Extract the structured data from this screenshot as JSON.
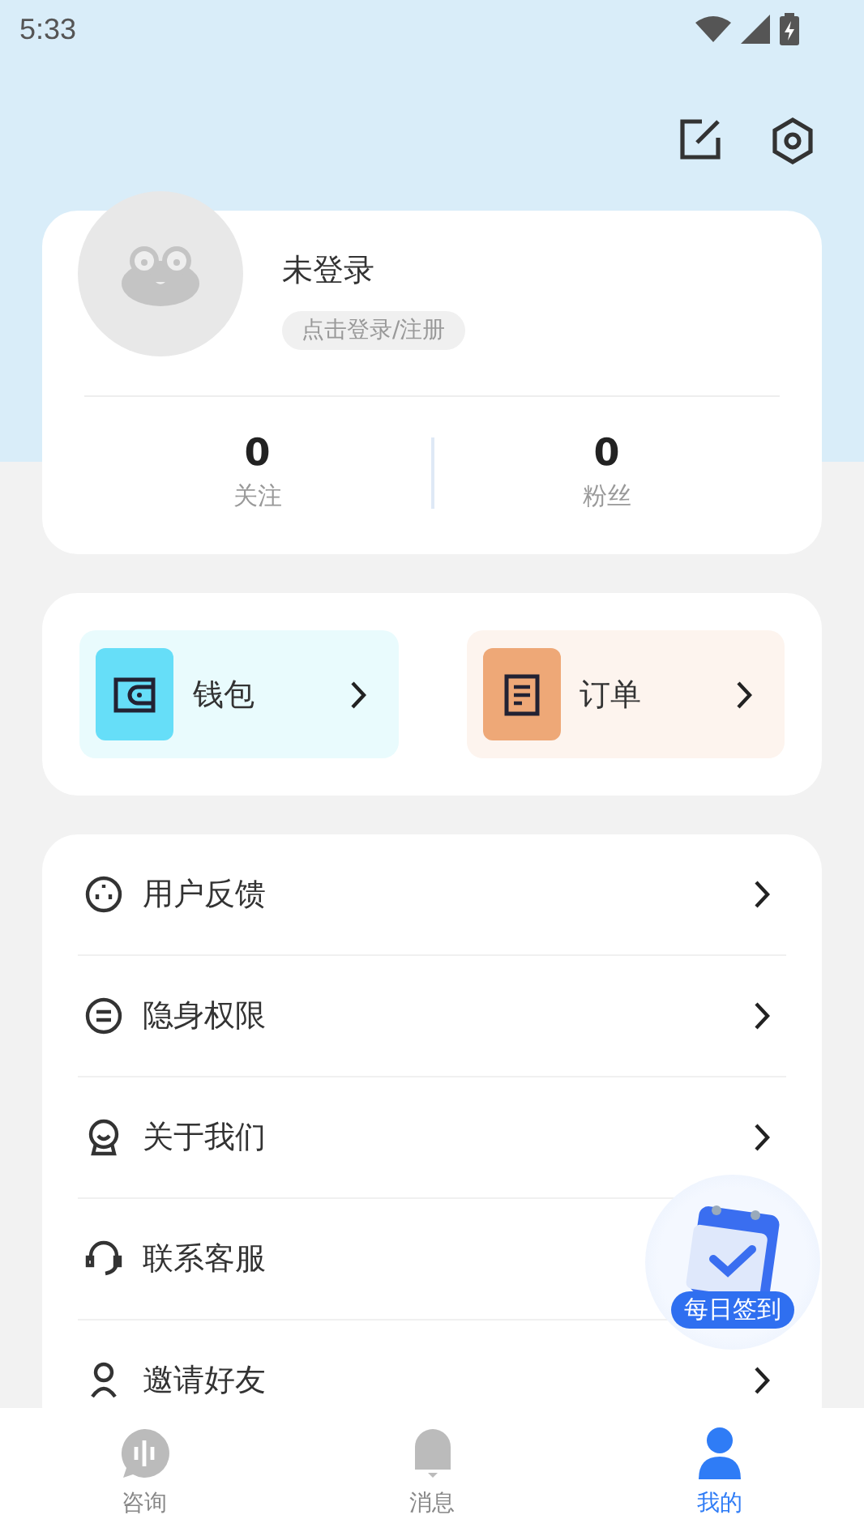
{
  "status_bar": {
    "time": "5:33"
  },
  "profile": {
    "name": "未登录",
    "login_button": "点击登录/注册",
    "stats": [
      {
        "value": "0",
        "label": "关注"
      },
      {
        "value": "0",
        "label": "粉丝"
      }
    ]
  },
  "shortcuts": [
    {
      "kind": "wallet",
      "label": "钱包"
    },
    {
      "kind": "order",
      "label": "订单"
    }
  ],
  "menu": [
    {
      "kind": "feedback",
      "label": "用户反馈"
    },
    {
      "kind": "privacy",
      "label": "隐身权限"
    },
    {
      "kind": "about",
      "label": "关于我们"
    },
    {
      "kind": "service",
      "label": "联系客服"
    },
    {
      "kind": "invite",
      "label": "邀请好友"
    }
  ],
  "sign_in_badge": {
    "label": "每日签到"
  },
  "tabs": [
    {
      "kind": "consult",
      "label": "咨询",
      "selected": false
    },
    {
      "kind": "messages",
      "label": "消息",
      "selected": false
    },
    {
      "kind": "me",
      "label": "我的",
      "selected": true
    }
  ]
}
